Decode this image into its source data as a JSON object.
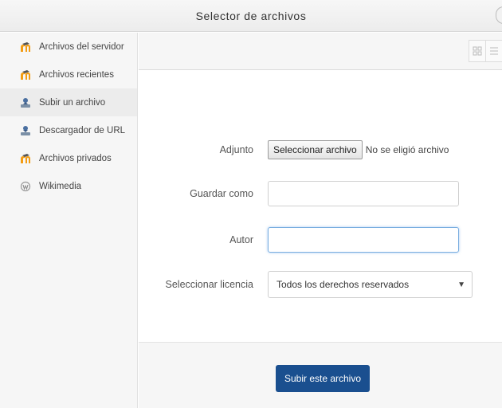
{
  "dialog": {
    "title": "Selector de archivos"
  },
  "sidebar": {
    "items": [
      {
        "label": "Archivos del servidor",
        "icon": "moodle-icon"
      },
      {
        "label": "Archivos recientes",
        "icon": "moodle-icon"
      },
      {
        "label": "Subir un archivo",
        "icon": "upload-icon",
        "active": true
      },
      {
        "label": "Descargador de URL",
        "icon": "download-icon"
      },
      {
        "label": "Archivos privados",
        "icon": "moodle-icon"
      },
      {
        "label": "Wikimedia",
        "icon": "wikimedia-icon"
      }
    ]
  },
  "toolbar": {
    "view_icons": [
      "grid-view-icon",
      "list-view-icon"
    ]
  },
  "form": {
    "attachment_label": "Adjunto",
    "choose_file_button": "Seleccionar archivo",
    "no_file_text": "No se eligió archivo",
    "save_as_label": "Guardar como",
    "save_as_value": "",
    "author_label": "Autor",
    "author_value": "",
    "license_label": "Seleccionar licencia",
    "license_selected": "Todos los derechos reservados"
  },
  "footer": {
    "submit_button": "Subir este archivo"
  },
  "colors": {
    "primary": "#1a4f8f",
    "moodle_orange": "#f39c12",
    "focus": "#7aaee0"
  }
}
